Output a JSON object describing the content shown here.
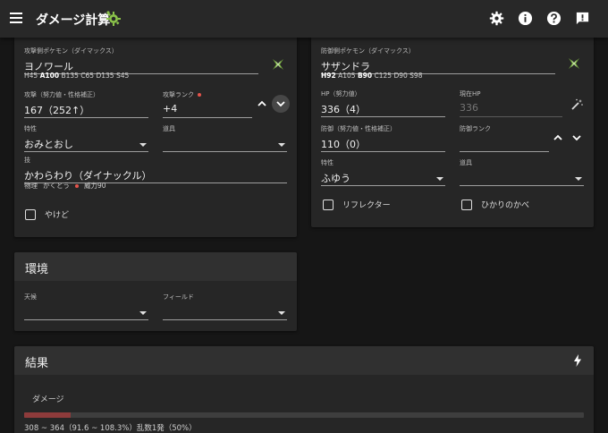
{
  "appbar": {
    "title": "ダメージ計算",
    "icons": [
      "menu-icon",
      "pokeball-gear-icon",
      "settings-icon",
      "info-icon",
      "help-icon",
      "feedback-icon"
    ]
  },
  "attacker": {
    "pokemon_label": "攻撃側ポケモン（ダイマックス）",
    "pokemon_value": "ヨノワール",
    "stats": {
      "h": "H45",
      "a": "A100",
      "b": "B135",
      "c": "C65",
      "d": "D135",
      "s": "S45"
    },
    "attack_label": "攻撃（努力値・性格補正）",
    "attack_value": "167（252↑）",
    "rank_label": "攻撃ランク",
    "rank_value": "+4",
    "ability_label": "特性",
    "ability_value": "おみとおし",
    "item_label": "道具",
    "item_value": "",
    "move_label": "技",
    "move_value": "かわらわり（ダイナックル）",
    "move_category": "物理",
    "move_type": "かくとう",
    "move_power": "威力90",
    "burn_label": "やけど"
  },
  "defender": {
    "pokemon_label": "防御側ポケモン（ダイマックス）",
    "pokemon_value": "サザンドラ",
    "stats": {
      "h": "H92",
      "a": "A105",
      "b": "B90",
      "c": "C125",
      "d": "D90",
      "s": "S98"
    },
    "hp_label": "HP（努力値）",
    "hp_value": "336（4）",
    "current_hp_label": "現在HP",
    "current_hp_value": "336",
    "defense_label": "防御（努力値・性格補正）",
    "defense_value": "110（0）",
    "rank_label": "防御ランク",
    "rank_value": "",
    "ability_label": "特性",
    "ability_value": "ふゆう",
    "item_label": "道具",
    "item_value": "",
    "reflect_label": "リフレクター",
    "light_screen_label": "ひかりのかべ"
  },
  "environment": {
    "title": "環境",
    "weather_label": "天候",
    "weather_value": "",
    "field_label": "フィールド",
    "field_value": ""
  },
  "result": {
    "title": "結果",
    "damage_label": "ダメージ",
    "damage_fraction": 0.083,
    "damage_text": "308 ~ 364（91.6 ~ 108.3%）乱数1発（50%）"
  },
  "colors": {
    "appbar": "#282828",
    "card": "#262626",
    "accent_green": "#8bc34a",
    "required_dot": "#e5534b",
    "damage_bar": "#8e3b3b"
  }
}
